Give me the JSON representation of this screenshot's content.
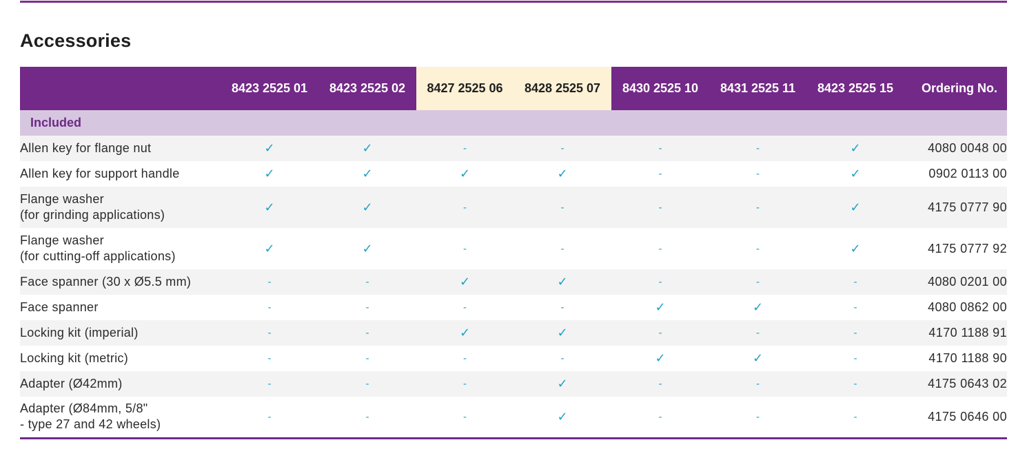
{
  "title": "Accessories",
  "columns": [
    "8423 2525 01",
    "8423 2525 02",
    "8427 2525 06",
    "8428 2525 07",
    "8430 2525 10",
    "8431 2525 11",
    "8423 2525 15"
  ],
  "ordering_header": "Ordering No.",
  "group_label": "Included",
  "symbols": {
    "yes": "✓",
    "no": "-"
  },
  "colors": {
    "header": "#732987",
    "highlight": "#fdf1d6",
    "group": "#d7c6e0",
    "check": "#1fa0c4"
  },
  "rows": [
    {
      "name": [
        "Allen key for flange nut"
      ],
      "marks": [
        "yes",
        "yes",
        "no",
        "no",
        "no",
        "no",
        "yes"
      ],
      "ordering_no": "4080 0048 00"
    },
    {
      "name": [
        "Allen key for support handle"
      ],
      "marks": [
        "yes",
        "yes",
        "yes",
        "yes",
        "no",
        "no",
        "yes"
      ],
      "ordering_no": "0902 0113 00"
    },
    {
      "name": [
        "Flange washer",
        "(for grinding applications)"
      ],
      "marks": [
        "yes",
        "yes",
        "no",
        "no",
        "no",
        "no",
        "yes"
      ],
      "ordering_no": "4175 0777 90"
    },
    {
      "name": [
        "Flange washer",
        "(for cutting-off applications)"
      ],
      "marks": [
        "yes",
        "yes",
        "no",
        "no",
        "no",
        "no",
        "yes"
      ],
      "ordering_no": "4175 0777 92"
    },
    {
      "name": [
        "Face spanner (30 x Ø5.5 mm)"
      ],
      "marks": [
        "no",
        "no",
        "yes",
        "yes",
        "no",
        "no",
        "no"
      ],
      "ordering_no": "4080 0201 00"
    },
    {
      "name": [
        "Face spanner"
      ],
      "marks": [
        "no",
        "no",
        "no",
        "no",
        "yes",
        "yes",
        "no"
      ],
      "ordering_no": "4080 0862 00"
    },
    {
      "name": [
        "Locking kit (imperial)"
      ],
      "marks": [
        "no",
        "no",
        "yes",
        "yes",
        "no",
        "no",
        "no"
      ],
      "ordering_no": "4170 1188 91"
    },
    {
      "name": [
        "Locking kit (metric)"
      ],
      "marks": [
        "no",
        "no",
        "no",
        "no",
        "yes",
        "yes",
        "no"
      ],
      "ordering_no": "4170 1188 90"
    },
    {
      "name": [
        "Adapter (Ø42mm)"
      ],
      "marks": [
        "no",
        "no",
        "no",
        "yes",
        "no",
        "no",
        "no"
      ],
      "ordering_no": "4175 0643 02"
    },
    {
      "name": [
        "Adapter (Ø84mm, 5/8\"",
        "- type 27 and 42 wheels)"
      ],
      "marks": [
        "no",
        "no",
        "no",
        "yes",
        "no",
        "no",
        "no"
      ],
      "ordering_no": "4175 0646 00"
    }
  ]
}
